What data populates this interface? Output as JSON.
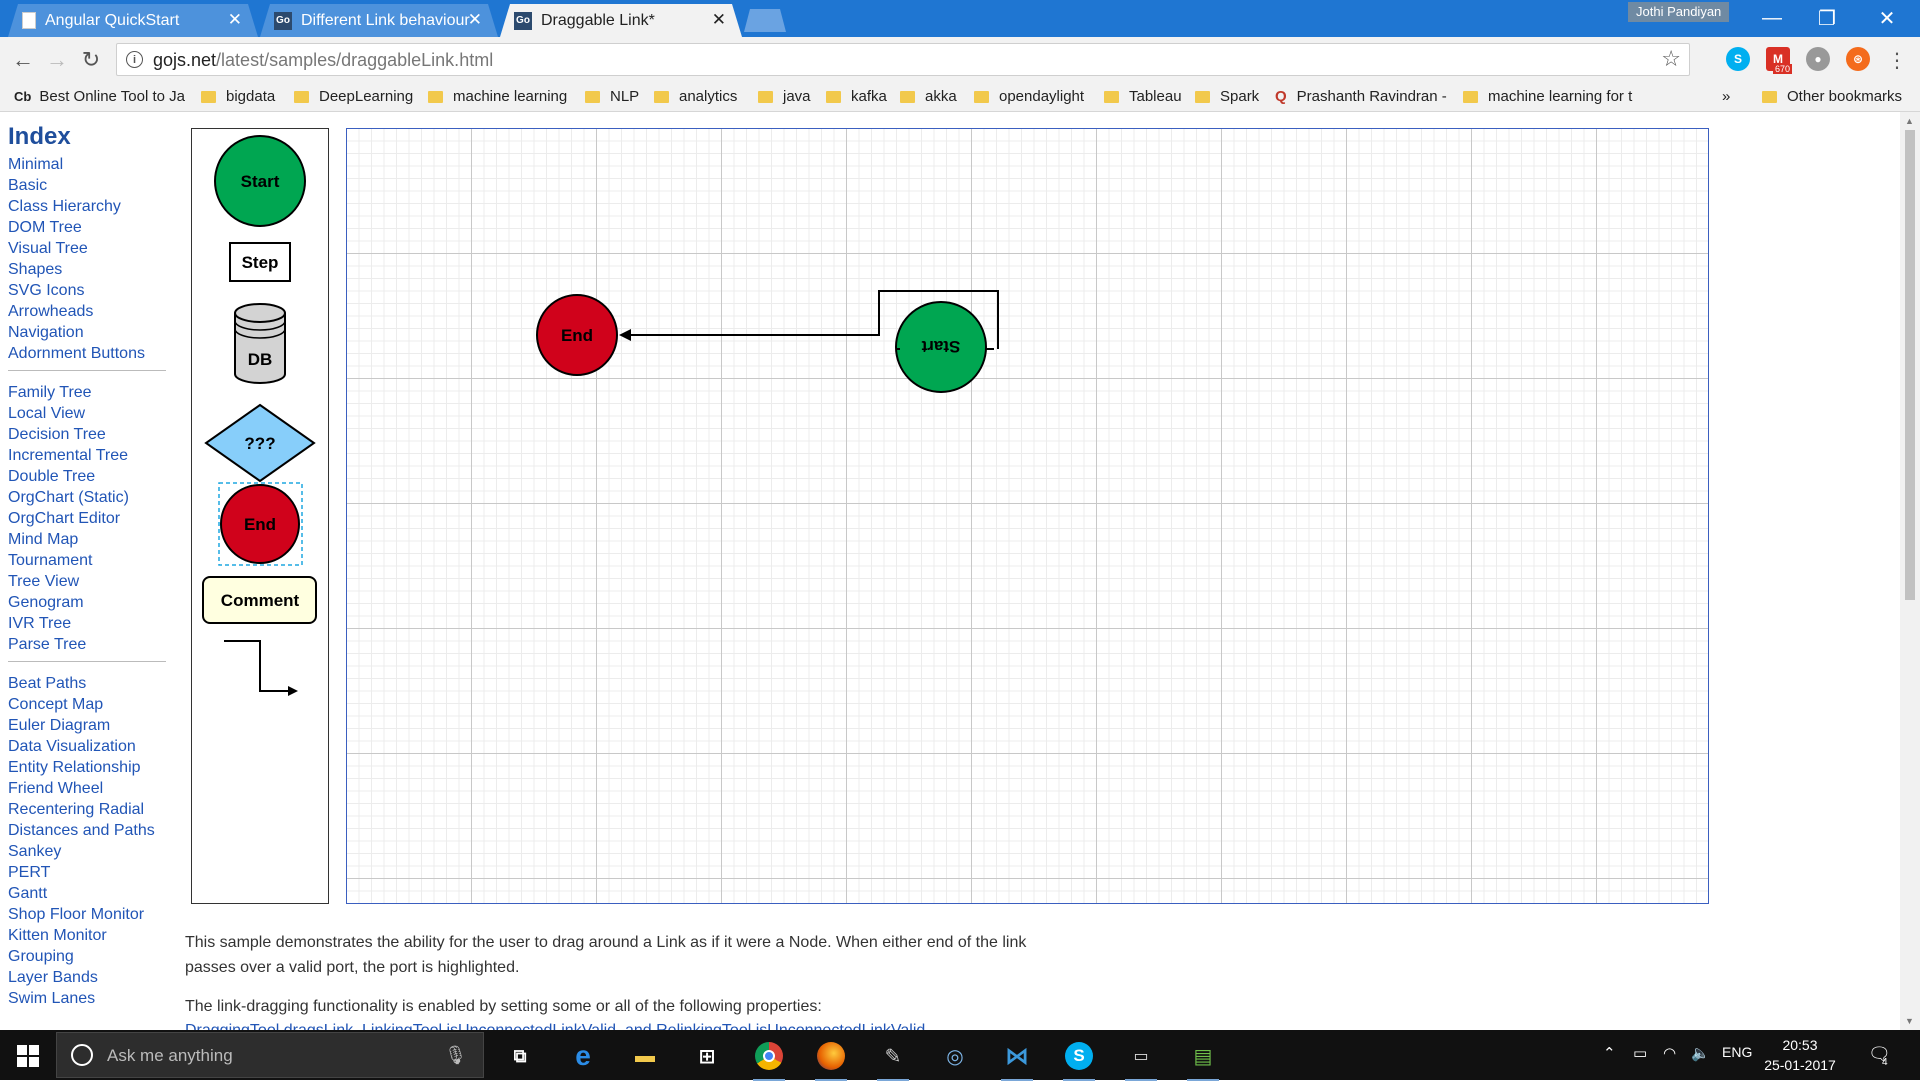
{
  "browser": {
    "tabs": [
      {
        "title": "Angular QuickStart",
        "icon": "page-icon"
      },
      {
        "title": "Different Link behaviour",
        "icon": "gojs-icon"
      },
      {
        "title": "Draggable Link*",
        "icon": "gojs-icon"
      }
    ],
    "profile_name": "Jothi Pandiyan",
    "url_host": "gojs.net",
    "url_path": "/latest/samples/draggableLink.html",
    "gmail_badge": "670",
    "bookmarks": [
      "Best Online Tool to Ja",
      "bigdata",
      "DeepLearning",
      "machine learning",
      "NLP",
      "analytics",
      "java",
      "kafka",
      "akka",
      "opendaylight",
      "Tableau",
      "Spark",
      "Prashanth Ravindran -",
      "machine learning for t"
    ],
    "bookmarks_overflow": "»",
    "other_bookmarks": "Other bookmarks",
    "colors": {
      "tab_bar": "#1f76d2",
      "toolbar": "#f2f2f2",
      "folder": "#f2c94c"
    }
  },
  "sidebar": {
    "title": "Index",
    "groups": [
      [
        "Minimal",
        "Basic",
        "Class Hierarchy",
        "DOM Tree",
        "Visual Tree",
        "Shapes",
        "SVG Icons",
        "Arrowheads",
        "Navigation",
        "Adornment Buttons"
      ],
      [
        "Family Tree",
        "Local View",
        "Decision Tree",
        "Incremental Tree",
        "Double Tree",
        "OrgChart (Static)",
        "OrgChart Editor",
        "Mind Map",
        "Tournament",
        "Tree View",
        "Genogram",
        "IVR Tree",
        "Parse Tree"
      ],
      [
        "Beat Paths",
        "Concept Map",
        "Euler Diagram",
        "Data Visualization",
        "Entity Relationship",
        "Friend Wheel",
        "Recentering Radial",
        "Distances and Paths",
        "Sankey",
        "PERT",
        "Gantt",
        "Shop Floor Monitor",
        "Kitten Monitor",
        "Grouping",
        "Layer Bands",
        "Swim Lanes"
      ]
    ]
  },
  "palette": {
    "start": "Start",
    "step": "Step",
    "db": "DB",
    "decision": "???",
    "end": "End",
    "comment": "Comment",
    "colors": {
      "start": "#00a651",
      "end": "#d0021b",
      "decision": "#87cefa",
      "comment": "#ffffe0"
    }
  },
  "diagram": {
    "end_node": "End",
    "start_node": "Start"
  },
  "description": {
    "para1": "This sample demonstrates the ability for the user to drag around a Link as if it were a Node. When either end of the link passes over a valid port, the port is highlighted.",
    "para2": "The link-dragging functionality is enabled by setting some or all of the following properties:",
    "para3_partial": "DraggingTool.dragsLink, LinkingTool.isUnconnectedLinkValid, and RelinkingTool.isUnconnectedLinkValid."
  },
  "taskbar": {
    "search_placeholder": "Ask me anything",
    "language": "ENG",
    "time": "20:53",
    "date": "25-01-2017",
    "notification_count": "4"
  }
}
